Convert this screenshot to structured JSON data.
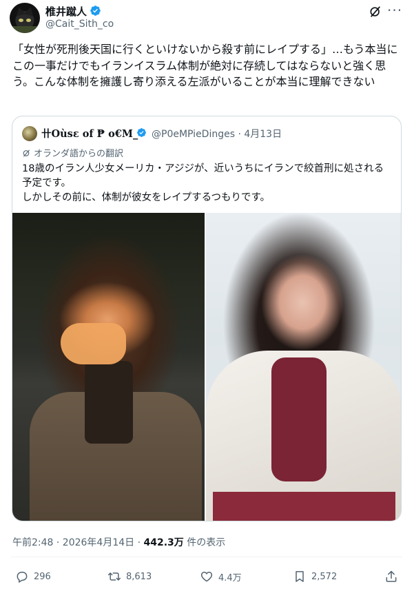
{
  "author": {
    "display_name": "椎井蹴人",
    "handle": "@Cait_Sith_co"
  },
  "tweet_text": "「女性が死刑後天国に行くといけないから殺す前にレイプする」…もう本当にこの一事だけでもイランイスラム体制が絶対に存続してはならないと強く思う。こんな体制を擁護し寄り添える左派がいることが本当に理解できない",
  "quote": {
    "display_name": "卄Oùsε of ₱ o€M_",
    "handle": "@P0eMPieDinges",
    "date": "4月13日",
    "meta": "@P0eMPieDinges · 4月13日",
    "translation_note": "オランダ語からの翻訳",
    "text": "18歳のイラン人少女メーリカ・アジジが、近いうちにイランで絞首刑に処される予定です。\nしかしその前に、体制が彼女をレイプするつもりです。"
  },
  "footer": {
    "time": "午前2:48 · 2026年4月14日 · ",
    "views": "442.3万",
    "views_suffix": " 件の表示"
  },
  "actions": {
    "replies": "296",
    "retweets": "8,613",
    "likes": "4.4万",
    "bookmarks": "2,572"
  },
  "colors": {
    "verified": "#1d9bf0",
    "text": "#0f1419",
    "muted": "#536471",
    "border": "#cfd9de"
  },
  "icons": [
    "verified-badge-icon",
    "grok-slash-icon",
    "more-icon",
    "translate-icon",
    "reply-icon",
    "retweet-icon",
    "like-icon",
    "bookmark-icon",
    "share-icon"
  ]
}
